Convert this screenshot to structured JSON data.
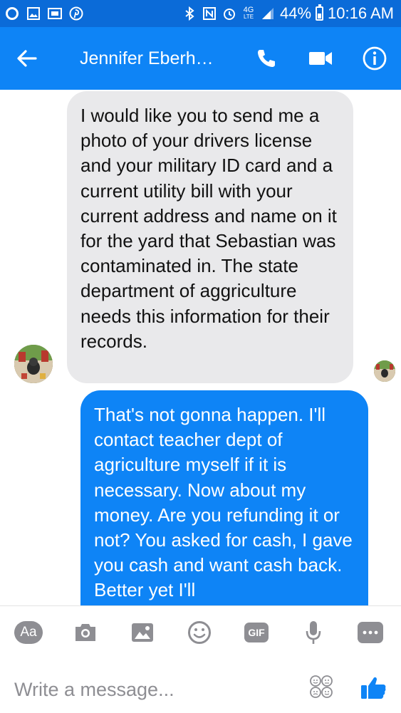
{
  "status_bar": {
    "network": "4G",
    "network_sub": "LTE",
    "battery": "44%",
    "battery_level": 0.44,
    "time": "10:16 AM",
    "notification_icons": [
      "circle-notification-icon",
      "gallery-notification-icon",
      "mail-notification-icon",
      "pinterest-icon"
    ],
    "status_icons": [
      "bluetooth-icon",
      "nfc-icon",
      "alarm-icon",
      "lte-icon",
      "signal-icon",
      "battery-icon"
    ]
  },
  "header": {
    "title": "Jennifer Eberh…",
    "back_icon": "arrow-left-icon",
    "actions": [
      "phone-icon",
      "video-camera-icon",
      "info-icon"
    ]
  },
  "messages": [
    {
      "direction": "incoming",
      "text": "I would like you to send me a photo of your drivers license and your military ID card and a current utility bill with your current address and name on it for the yard that Sebastian was contaminated in.  The state department of aggriculture needs this information for their records."
    },
    {
      "direction": "outgoing",
      "text": "That's not gonna happen. I'll contact teacher dept of agriculture myself if it is necessary. Now about my money. Are you refunding it or not? You asked for cash, I gave you cash and want cash back. Better yet I'll"
    }
  ],
  "composer": {
    "tools": [
      "Aa",
      "camera-icon",
      "image-icon",
      "emoji-icon",
      "GIF",
      "microphone-icon",
      "more-icon"
    ],
    "aa_label": "Aa",
    "gif_label": "GIF",
    "placeholder": "Write a message...",
    "emoji_picker_icon": "stickers-emoji-icon",
    "like_icon": "thumbs-up-icon"
  },
  "colors": {
    "status_bar": "#0b6bd8",
    "header": "#0e84f6",
    "incoming_bubble": "#e9e9eb",
    "outgoing_bubble": "#0e84f6",
    "toolbar_icon": "#8e8e93"
  }
}
